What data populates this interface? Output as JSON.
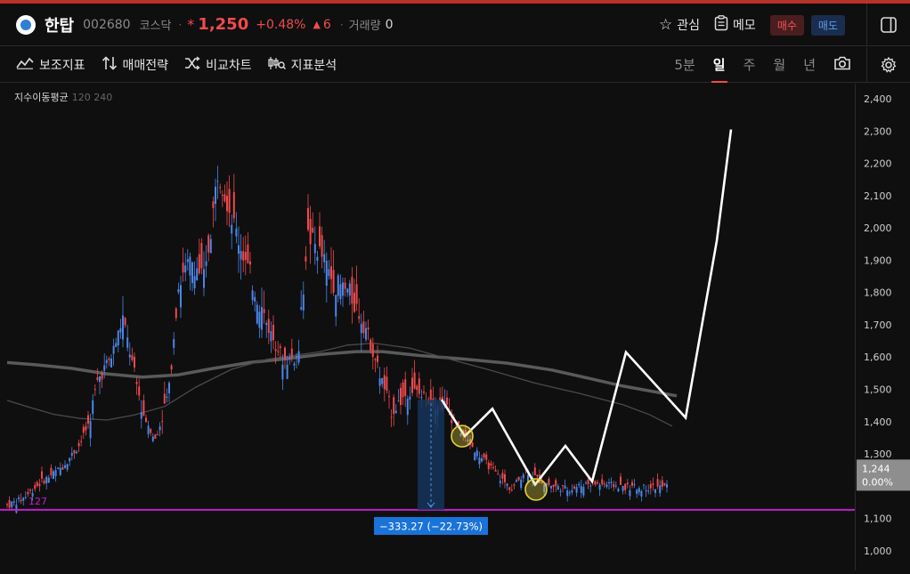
{
  "header": {
    "stock_name": "한탑",
    "code": "002680",
    "market": "코스닥",
    "separator": "·",
    "price_marker": "*",
    "price": "1,250",
    "change_pct": "+0.48%",
    "change_arrow": "▲",
    "change": "6",
    "volume_label": "거래량",
    "volume": "0",
    "watch_label": "관심",
    "memo_label": "메모",
    "buy_label": "매수",
    "sell_label": "매도"
  },
  "toolbar": {
    "indicator_label": "보조지표",
    "strategy_label": "매매전략",
    "compare_label": "비교차트",
    "analysis_label": "지표분석",
    "periods": [
      "5분",
      "일",
      "주",
      "월",
      "년"
    ],
    "active_period": "일"
  },
  "legend": {
    "name": "지수이동평균",
    "params": "120 240"
  },
  "chart_data": {
    "type": "candlestick",
    "y_axis_ticks": [
      "2,400",
      "2,300",
      "2,200",
      "2,100",
      "2,000",
      "1,900",
      "1,800",
      "1,700",
      "1,600",
      "1,500",
      "1,400",
      "1,300",
      "1,200",
      "1,100",
      "1,000"
    ],
    "ylim": [
      970,
      2430
    ],
    "current_price_label": "1,244",
    "current_change_label": "0.00%",
    "current_value": 1244,
    "support_level": 1127,
    "support_label": "127",
    "measure_label": "−333.27 (−22.73%)",
    "colors": {
      "up": "#f0494b",
      "down": "#4a87e8",
      "support": "#c020c8",
      "projection": "#ffffff",
      "highlight": "#e3d23c"
    }
  },
  "colors": {
    "accent_red": "#f04b4b",
    "accent_blue": "#5d9bf0",
    "background": "#0f0f10"
  }
}
